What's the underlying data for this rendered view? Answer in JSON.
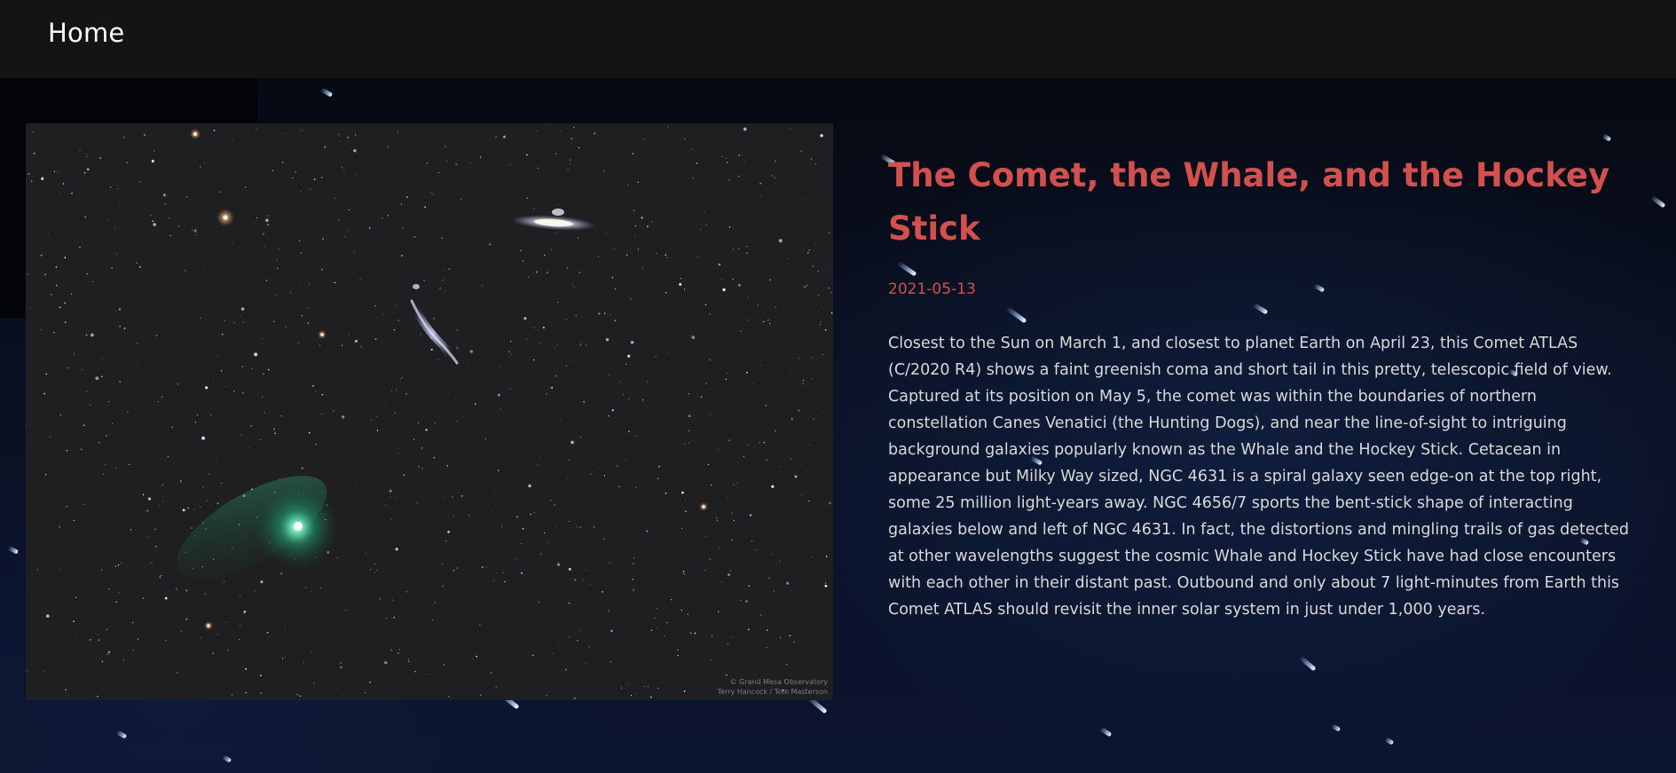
{
  "nav": {
    "home_label": "Home"
  },
  "apod": {
    "title": "The Comet, the Whale, and the Hockey Stick",
    "date": "2021-05-13",
    "explanation": "Closest to the Sun on March 1, and closest to planet Earth on April 23, this Comet ATLAS (C/2020 R4) shows a faint greenish coma and short tail in this pretty, telescopic field of view. Captured at its position on May 5, the comet was within the boundaries of northern constellation Canes Venatici (the Hunting Dogs), and near the line-of-sight to intriguing background galaxies popularly known as the Whale and the Hockey Stick. Cetacean in appearance but Milky Way sized, NGC 4631 is a spiral galaxy seen edge-on at the top right, some 25 million light-years away. NGC 4656/7 sports the bent-stick shape of interacting galaxies below and left of NGC 4631. In fact, the distortions and mingling trails of gas detected at other wavelengths suggest the cosmic Whale and Hockey Stick have had close encounters with each other in their distant past. Outbound and only about 7 light-minutes from Earth this Comet ATLAS should revisit the inner solar system in just under 1,000 years.",
    "image_credit_line1": "© Grand Mesa Observatory",
    "image_credit_line2": "Terry Hancock / Tom Masterson"
  },
  "colors": {
    "accent": "#d2504d",
    "topbar": "#141414",
    "text": "#d9d9d9",
    "comet_coma": "#3fd3a0"
  }
}
